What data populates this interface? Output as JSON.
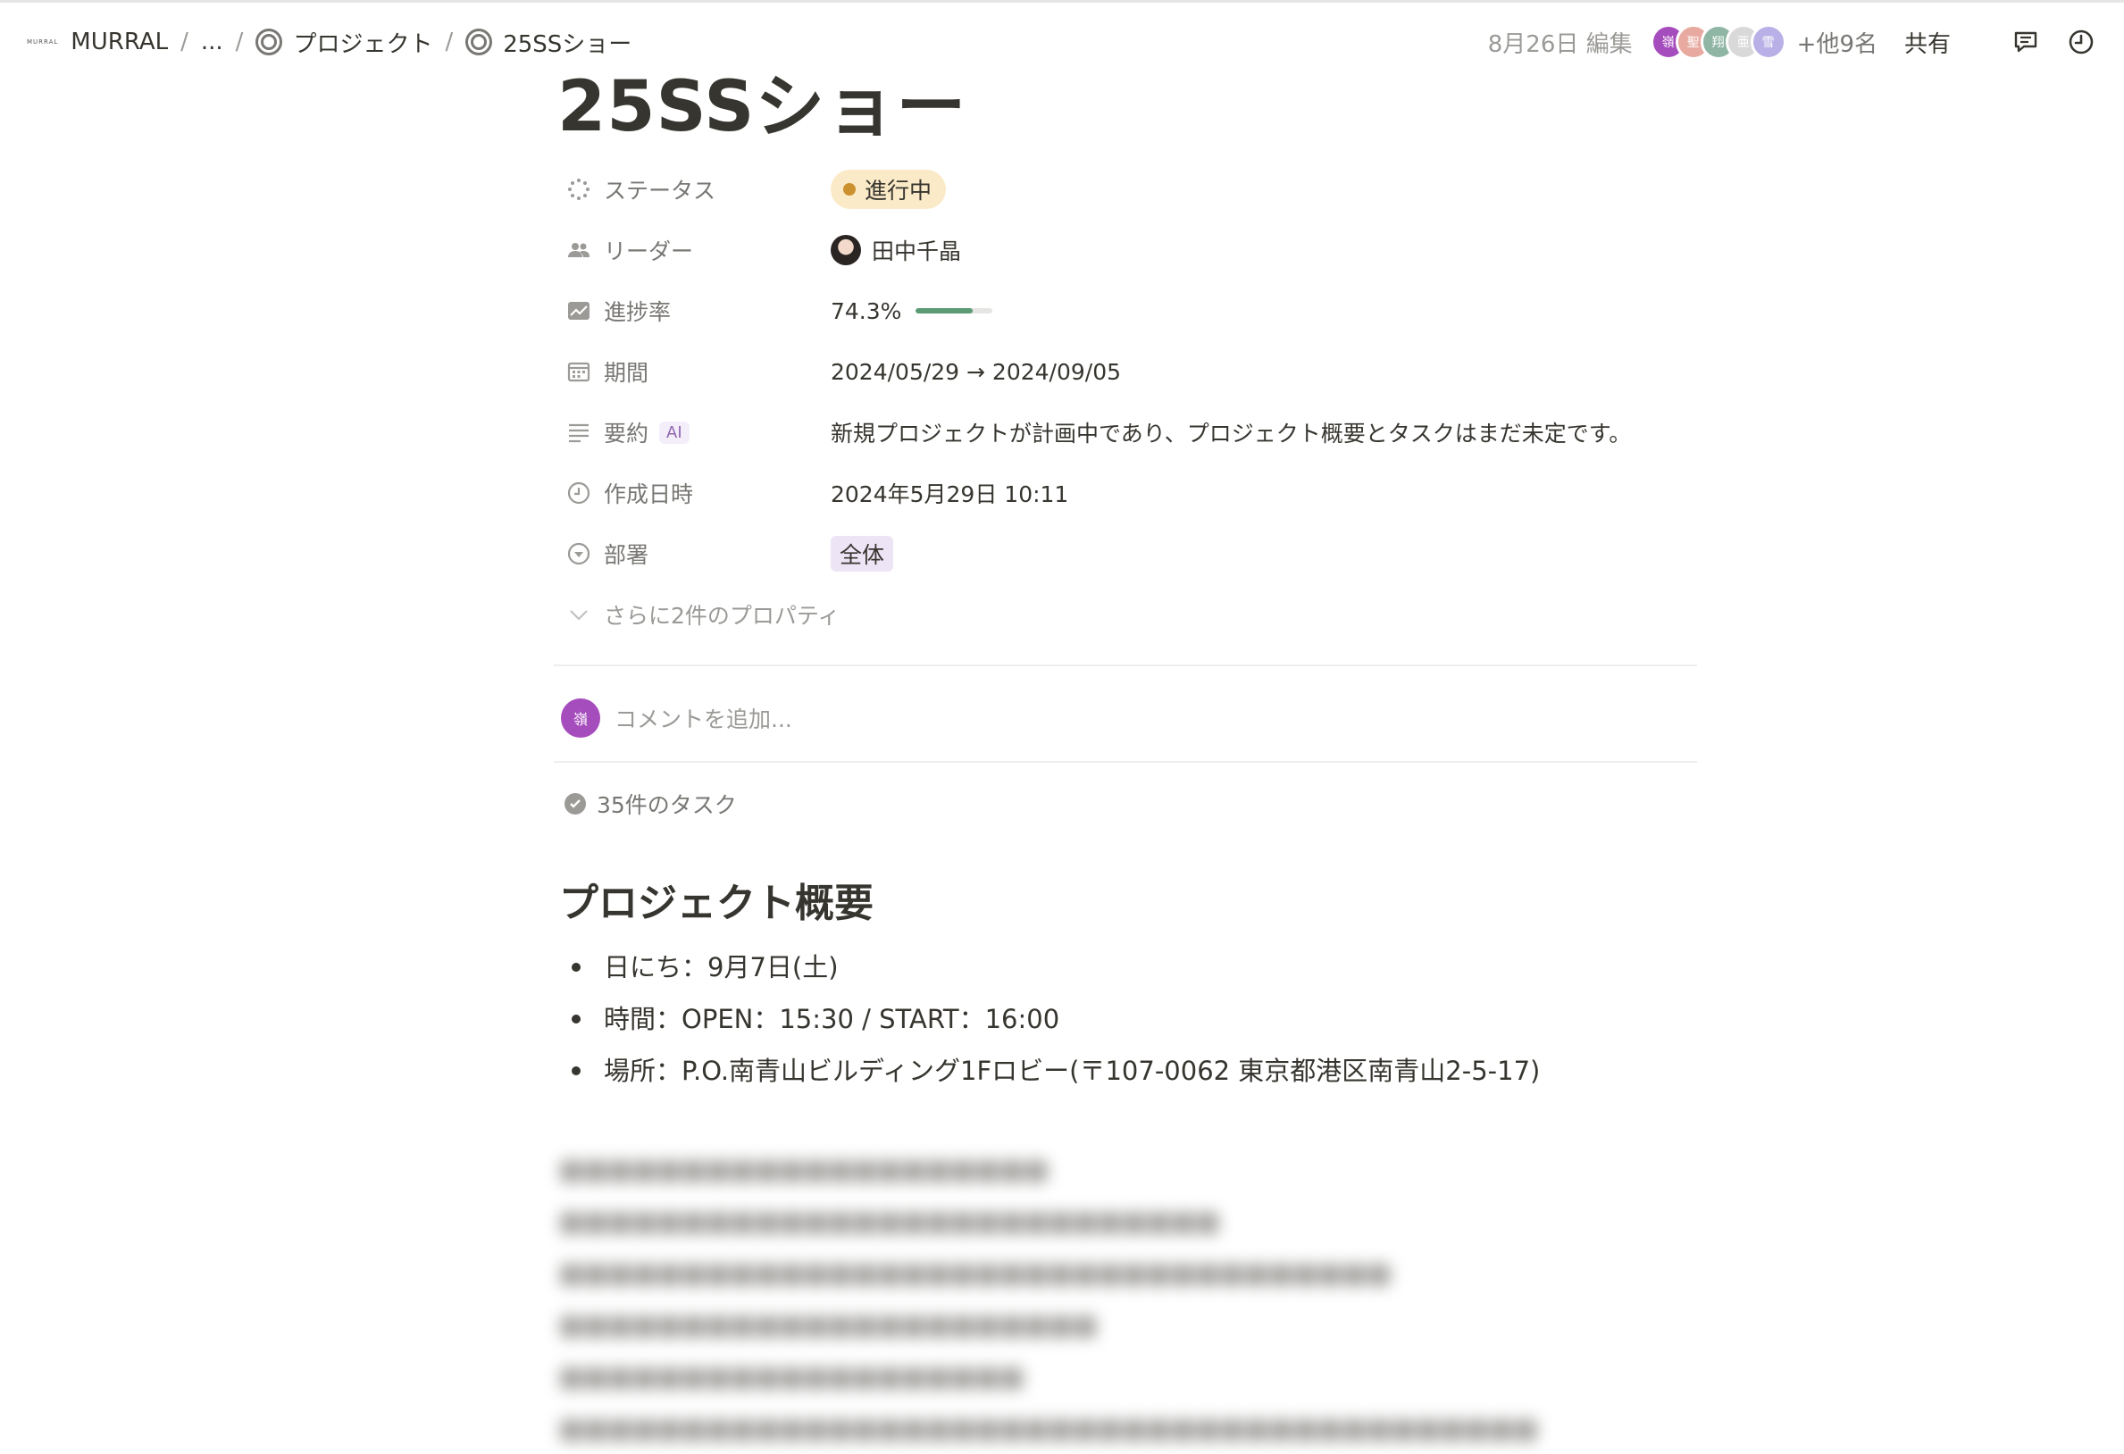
{
  "breadcrumb": {
    "workspace_logo": "MURRAL",
    "workspace": "MURRAL",
    "ellipsis": "...",
    "separator": "/",
    "parent": "プロジェクト",
    "current": "25SSショー"
  },
  "topbar": {
    "edited": "8月26日 編集",
    "avatars": [
      {
        "initial": "嶺",
        "color": "#a64dbd"
      },
      {
        "initial": "聖",
        "color": "#e8a9a0"
      },
      {
        "initial": "翔",
        "color": "#8fb5a4"
      },
      {
        "initial": "亜",
        "color": "#d9d9d9"
      },
      {
        "initial": "雪",
        "color": "#b8b0e6"
      }
    ],
    "more_users": "+他9名",
    "share": "共有",
    "icons": [
      "comment-icon",
      "history-icon"
    ]
  },
  "page": {
    "title": "25SSショー"
  },
  "properties": {
    "status": {
      "label": "ステータス",
      "value": "進行中",
      "color": "#fbeac7"
    },
    "leader": {
      "label": "リーダー",
      "value": "田中千晶"
    },
    "progress": {
      "label": "進捗率",
      "value": "74.3%",
      "fraction": 0.743
    },
    "period": {
      "label": "期間",
      "value": "2024/05/29 → 2024/09/05"
    },
    "summary": {
      "label": "要約",
      "ai_tag": "AI",
      "value": "新規プロジェクトが計画中であり、プロジェクト概要とタスクはまだ未定です。"
    },
    "created": {
      "label": "作成日時",
      "value": "2024年5月29日 10:11"
    },
    "department": {
      "label": "部署",
      "value": "全体"
    },
    "more": "さらに2件のプロパティ"
  },
  "comment": {
    "avatar_initial": "嶺",
    "placeholder": "コメントを追加..."
  },
  "tasks": {
    "label": "35件のタスク"
  },
  "overview": {
    "heading": "プロジェクト概要",
    "items": [
      "日にち：9月7日(土)",
      "時間：OPEN：15:30 / START：16:00",
      "場所：P.O.南青山ビルディング1Fロビー(〒107-0062 東京都港区南青山2-5-17)"
    ]
  }
}
